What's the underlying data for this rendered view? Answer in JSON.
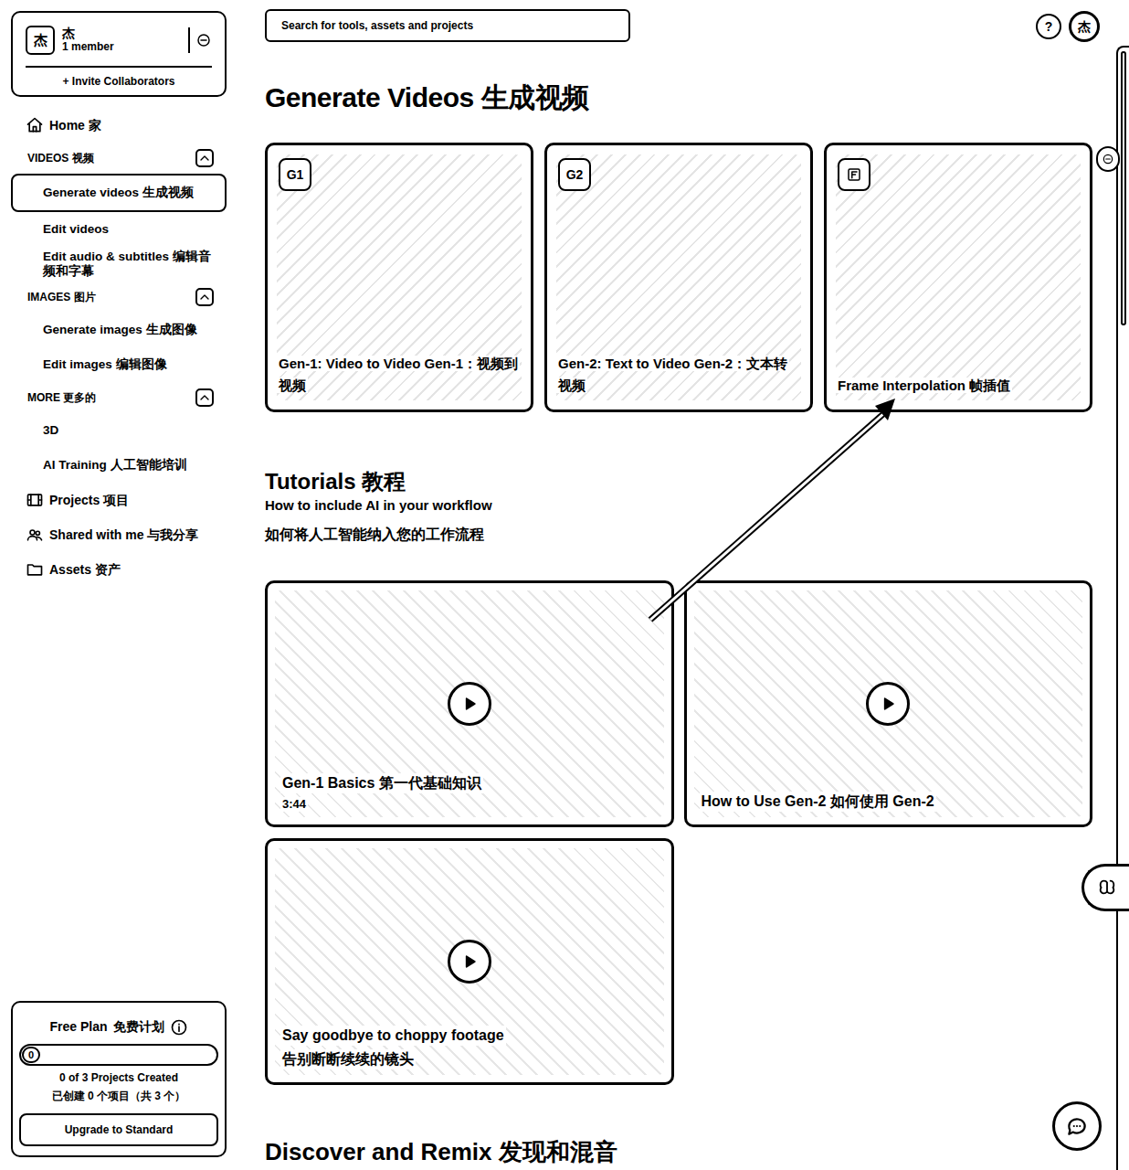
{
  "workspace": {
    "avatar": "杰",
    "name": "杰",
    "members": "1 member",
    "invite": "+ Invite Collaborators"
  },
  "sidebar": {
    "items": [
      {
        "kind": "link",
        "label": "Home 家",
        "selected": false
      },
      {
        "kind": "section",
        "label": "VIDEOS 视频",
        "expanded": true
      },
      {
        "kind": "sublink",
        "label": "Generate videos 生成视频",
        "selected": true
      },
      {
        "kind": "sublink",
        "label": "Edit videos",
        "selected": false
      },
      {
        "kind": "sublink",
        "label": "Edit audio & subtitles 编辑音频和字幕",
        "selected": false
      },
      {
        "kind": "section",
        "label": "IMAGES 图片",
        "expanded": true
      },
      {
        "kind": "sublink",
        "label": "Generate images 生成图像",
        "selected": false
      },
      {
        "kind": "sublink",
        "label": "Edit images 编辑图像",
        "selected": false
      },
      {
        "kind": "section",
        "label": "MORE 更多的",
        "expanded": true
      },
      {
        "kind": "sublink",
        "label": "3D",
        "selected": false
      },
      {
        "kind": "sublink",
        "label": "AI Training 人工智能培训",
        "selected": false
      },
      {
        "kind": "link",
        "label": "Projects 项目",
        "selected": false
      },
      {
        "kind": "link",
        "label": "Shared with me 与我分享",
        "selected": false
      },
      {
        "kind": "link",
        "label": "Assets 资产",
        "selected": false
      }
    ]
  },
  "plan": {
    "name": "Free Plan",
    "name_zh": "免费计划",
    "progress": {
      "reading": "0",
      "level": 0
    },
    "count": "0 of 3 Projects Created",
    "count_zh": "已创建 0 个项目（共 3 个）",
    "button": "Upgrade to Standard"
  },
  "search": {
    "placeholder": "Search for tools, assets and projects"
  },
  "header": {
    "help": "?",
    "avatar": "杰"
  },
  "generate": {
    "title": "Generate Videos 生成视频",
    "cards": [
      {
        "kind": "text-badge",
        "badge": "G1",
        "label": "Gen-1: Video to Video Gen-1：视频到视频"
      },
      {
        "kind": "text-badge",
        "badge": "G2",
        "label": "Gen-2: Text to Video Gen-2：文本转视频"
      },
      {
        "kind": "icon-badge",
        "label": "Frame Interpolation 帧插值"
      }
    ]
  },
  "tutorials": {
    "title": "Tutorials 教程",
    "subtitle": "How to include AI in your workflow",
    "subtitle_zh": "如何将人工智能纳入您的工作流程",
    "videos": [
      {
        "title": "Gen-1 Basics 第一代基础知识",
        "meta": "3:44"
      },
      {
        "title": "How to Use Gen-2 如何使用 Gen-2"
      },
      {
        "title": "Say goodbye to choppy footage",
        "subtitle": "告别断断续续的镜头"
      }
    ]
  },
  "discover": {
    "title": "Discover and Remix 发现和混音"
  }
}
